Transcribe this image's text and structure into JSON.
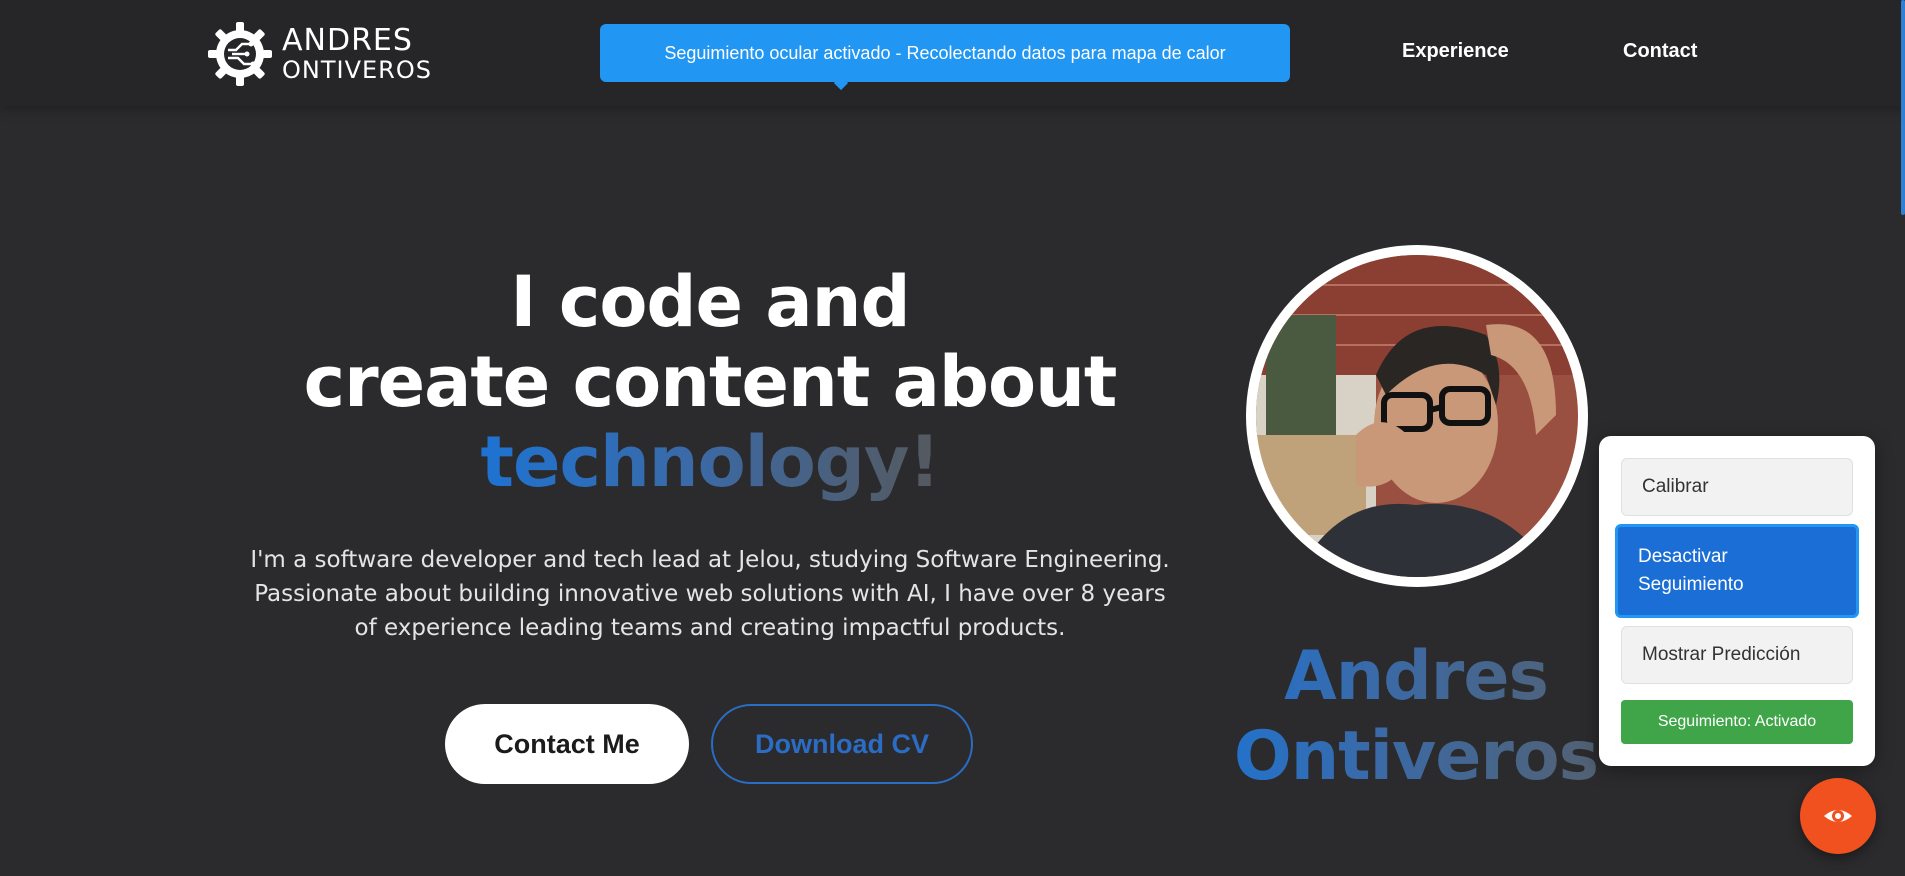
{
  "header": {
    "logo": {
      "line1": "ANDRES",
      "line2": "ONTIVEROS",
      "icon": "gear-circuit-icon"
    },
    "tracking_banner": "Seguimiento ocular activado - Recolectando datos para mapa de calor",
    "nav": [
      {
        "label": "Experience"
      },
      {
        "label": "Contact"
      }
    ]
  },
  "hero": {
    "title_line1": "I code and",
    "title_line2": "create content about",
    "title_highlight": "technology!",
    "description": "I'm a software developer and tech lead at Jelou, studying Software Engineering. Passionate about building innovative web solutions with AI, I have over 8 years of experience leading teams and creating impactful products.",
    "contact_button": "Contact Me",
    "cv_button": "Download CV"
  },
  "profile": {
    "name_line1": "Andres",
    "name_line2": "Ontiveros"
  },
  "eye_panel": {
    "calibrate": "Calibrar",
    "deactivate": "Desactivar Seguimiento",
    "show_prediction": "Mostrar Predicción",
    "status": "Seguimiento: Activado",
    "fab_icon": "eye-icon"
  },
  "colors": {
    "background": "#2b2b2d",
    "accent_blue": "#2196f3",
    "gradient_start": "#1e73d2",
    "status_green": "#3fa548",
    "fab_orange": "#f0511f"
  }
}
